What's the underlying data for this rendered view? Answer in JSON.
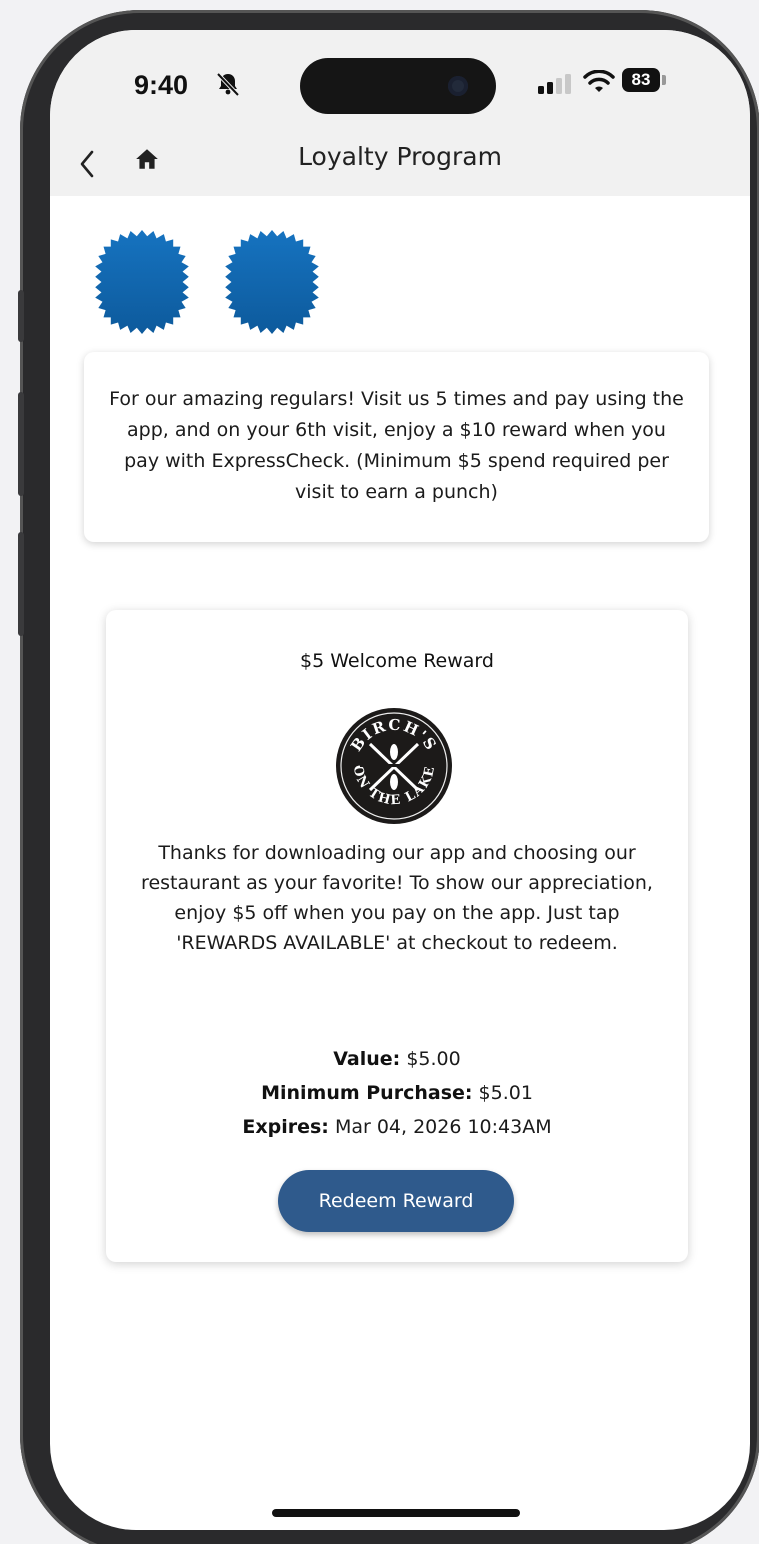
{
  "status_bar": {
    "time": "9:40",
    "battery": "83"
  },
  "nav": {
    "title": "Loyalty Program"
  },
  "punch_card": {
    "punches_earned": 2,
    "punch_color": "#1268b0"
  },
  "info": {
    "text": "For our amazing regulars! Visit us 5 times and pay using the app, and on your 6th visit, enjoy a $10 reward when you pay with ExpressCheck. (Minimum $5 spend required per visit to earn a punch)"
  },
  "reward": {
    "title": "$5 Welcome Reward",
    "logo_text": "BIRCH'S ON THE LAKE",
    "description": "Thanks for downloading our app and choosing our restaurant as your favorite! To show our appreciation, enjoy $5 off when you pay on the app. Just tap 'REWARDS AVAILABLE' at checkout to redeem.",
    "value_label": "Value:",
    "value": "$5.00",
    "min_purchase_label": "Minimum Purchase:",
    "min_purchase": "$5.01",
    "expires_label": "Expires:",
    "expires": "Mar 04, 2026 10:43AM",
    "button_label": "Redeem Reward"
  },
  "colors": {
    "accent": "#2f5a8c",
    "punch": "#1268b0"
  }
}
